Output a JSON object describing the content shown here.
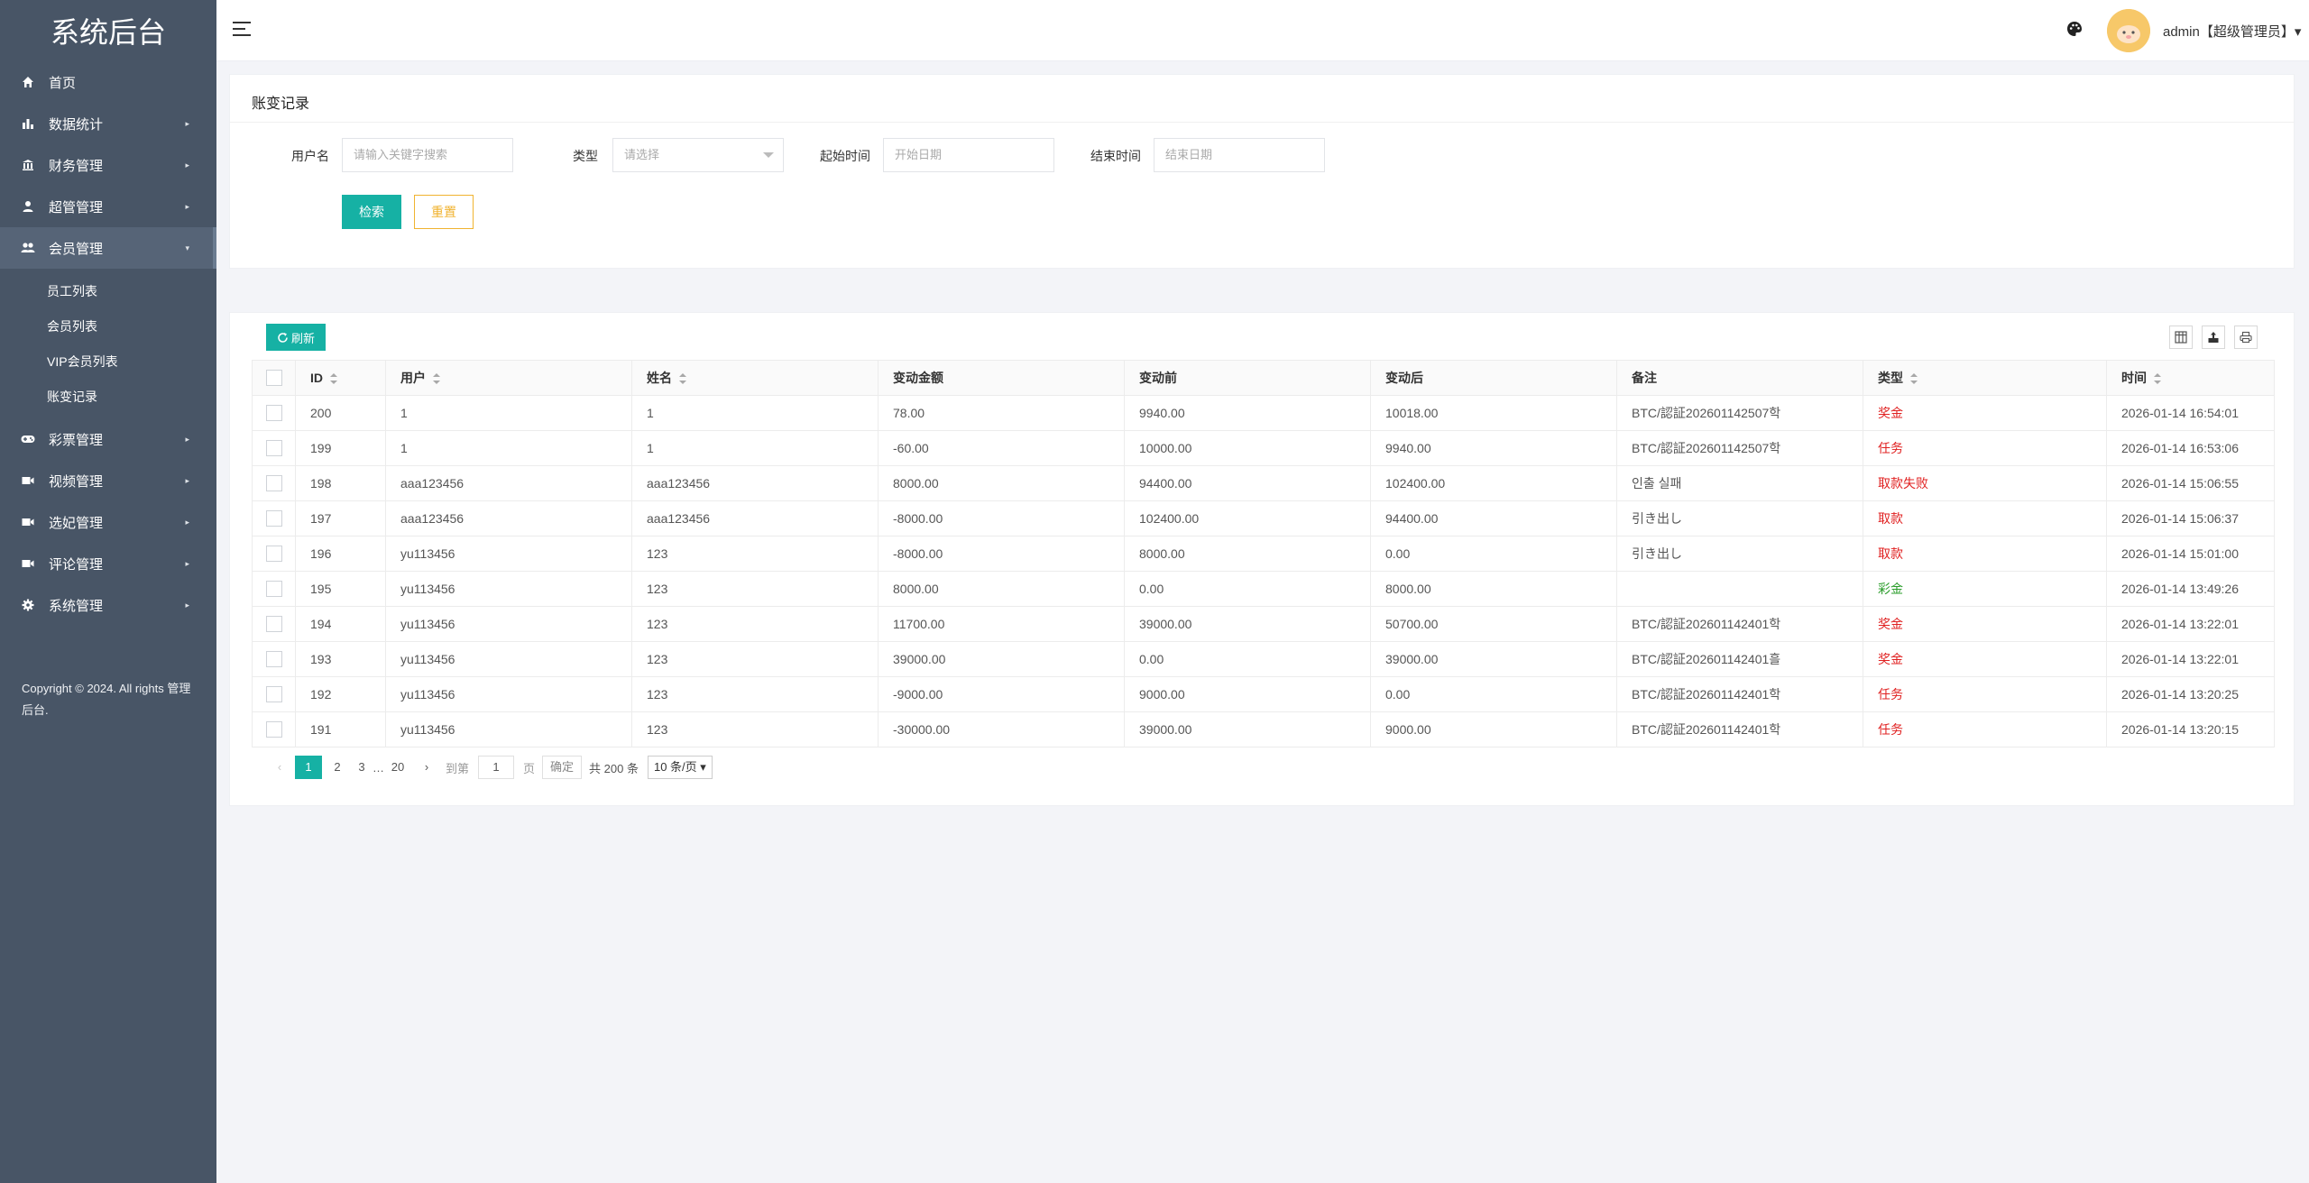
{
  "sidebar": {
    "brand": "系统后台",
    "items": [
      {
        "label": "首页",
        "icon": "home-icon",
        "arrow": ""
      },
      {
        "label": "数据统计",
        "icon": "bar-chart-icon",
        "arrow": "▸"
      },
      {
        "label": "财务管理",
        "icon": "bank-icon",
        "arrow": "▸"
      },
      {
        "label": "超管管理",
        "icon": "user-icon",
        "arrow": "▸"
      },
      {
        "label": "会员管理",
        "icon": "users-icon",
        "arrow": "▾"
      },
      {
        "label": "彩票管理",
        "icon": "gamepad-icon",
        "arrow": "▸"
      },
      {
        "label": "视频管理",
        "icon": "video-icon",
        "arrow": "▸"
      },
      {
        "label": "选妃管理",
        "icon": "video-icon",
        "arrow": "▸"
      },
      {
        "label": "评论管理",
        "icon": "video-icon",
        "arrow": "▸"
      },
      {
        "label": "系统管理",
        "icon": "gear-icon",
        "arrow": "▸"
      }
    ],
    "sub_items": [
      "员工列表",
      "会员列表",
      "VIP会员列表",
      "账变记录"
    ],
    "copyright": "Copyright © 2024. All rights 管理后台."
  },
  "topbar": {
    "user": "admin【超级管理员】▾"
  },
  "search": {
    "title": "账变记录",
    "username_label": "用户名",
    "username_placeholder": "请输入关键字搜索",
    "type_label": "类型",
    "type_placeholder": "请选择",
    "start_label": "起始时间",
    "start_placeholder": "开始日期",
    "end_label": "结束时间",
    "end_placeholder": "结束日期",
    "search_btn": "检索",
    "reset_btn": "重置"
  },
  "table": {
    "refresh": "刷新",
    "headers": [
      "ID",
      "用户",
      "姓名",
      "变动金额",
      "变动前",
      "变动后",
      "备注",
      "类型",
      "时间"
    ],
    "rows": [
      {
        "id": "200",
        "user": "1",
        "name": "1",
        "amount": "78.00",
        "before": "9940.00",
        "after": "10018.00",
        "note": "BTC/認証202601142507학",
        "type": "奖金",
        "tcolor": "red",
        "time": "2026-01-14 16:54:01"
      },
      {
        "id": "199",
        "user": "1",
        "name": "1",
        "amount": "-60.00",
        "before": "10000.00",
        "after": "9940.00",
        "note": "BTC/認証202601142507학",
        "type": "任务",
        "tcolor": "red",
        "time": "2026-01-14 16:53:06"
      },
      {
        "id": "198",
        "user": "aaa123456",
        "name": "aaa123456",
        "amount": "8000.00",
        "before": "94400.00",
        "after": "102400.00",
        "note": "인출 실패",
        "type": "取款失败",
        "tcolor": "red",
        "time": "2026-01-14 15:06:55"
      },
      {
        "id": "197",
        "user": "aaa123456",
        "name": "aaa123456",
        "amount": "-8000.00",
        "before": "102400.00",
        "after": "94400.00",
        "note": "引き出し",
        "type": "取款",
        "tcolor": "red",
        "time": "2026-01-14 15:06:37"
      },
      {
        "id": "196",
        "user": "yu113456",
        "name": "123",
        "amount": "-8000.00",
        "before": "8000.00",
        "after": "0.00",
        "note": "引き出し",
        "type": "取款",
        "tcolor": "red",
        "time": "2026-01-14 15:01:00"
      },
      {
        "id": "195",
        "user": "yu113456",
        "name": "123",
        "amount": "8000.00",
        "before": "0.00",
        "after": "8000.00",
        "note": "",
        "type": "彩金",
        "tcolor": "green",
        "time": "2026-01-14 13:49:26"
      },
      {
        "id": "194",
        "user": "yu113456",
        "name": "123",
        "amount": "11700.00",
        "before": "39000.00",
        "after": "50700.00",
        "note": "BTC/認証202601142401학",
        "type": "奖金",
        "tcolor": "red",
        "time": "2026-01-14 13:22:01"
      },
      {
        "id": "193",
        "user": "yu113456",
        "name": "123",
        "amount": "39000.00",
        "before": "0.00",
        "after": "39000.00",
        "note": "BTC/認証202601142401흘",
        "type": "奖金",
        "tcolor": "red",
        "time": "2026-01-14 13:22:01"
      },
      {
        "id": "192",
        "user": "yu113456",
        "name": "123",
        "amount": "-9000.00",
        "before": "9000.00",
        "after": "0.00",
        "note": "BTC/認証202601142401학",
        "type": "任务",
        "tcolor": "red",
        "time": "2026-01-14 13:20:25"
      },
      {
        "id": "191",
        "user": "yu113456",
        "name": "123",
        "amount": "-30000.00",
        "before": "39000.00",
        "after": "9000.00",
        "note": "BTC/認証202601142401학",
        "type": "任务",
        "tcolor": "red",
        "time": "2026-01-14 13:20:15"
      }
    ]
  },
  "pager": {
    "prev": "‹",
    "pages": [
      "1",
      "2",
      "3"
    ],
    "ellipsis": "…",
    "last": "20",
    "next": "›",
    "goto_label": "到第",
    "goto_value": "1",
    "page_unit": "页",
    "confirm": "确定",
    "total": "共 200 条",
    "per_page": "10 条/页 ▾"
  }
}
